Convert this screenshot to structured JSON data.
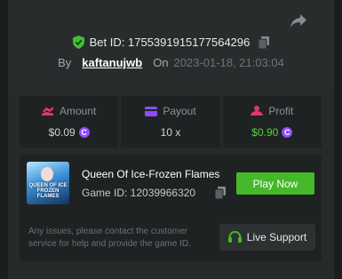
{
  "bet": {
    "id_text": "Bet ID: 1755391915177564296",
    "by_label": "By",
    "username": "kaftanujwb",
    "on_label": "On",
    "date": "2023-01-18, 21:03:04"
  },
  "stats": [
    {
      "label": "Amount",
      "value": "$0.09",
      "icon": "amount-icon",
      "color": "#e0386e"
    },
    {
      "label": "Payout",
      "value": "10 x",
      "icon": "payout-icon",
      "color": "#8e4cff"
    },
    {
      "label": "Profit",
      "value": "$0.90",
      "icon": "profit-icon",
      "color": "#e0386e"
    }
  ],
  "game": {
    "title": "Queen Of Ice-Frozen Flames",
    "id_text": "Game ID: 12039966320",
    "thumb_text": "QUEEN OF ICE FROZEN FLAMES",
    "play_label": "Play Now"
  },
  "support": {
    "message": "Any issues, please contact the customer service for help and provide the game ID.",
    "button_label": "Live Support"
  },
  "colors": {
    "accent_green": "#45b829",
    "profit_green": "#53d63a",
    "coin_purple": "#8e4cff"
  }
}
